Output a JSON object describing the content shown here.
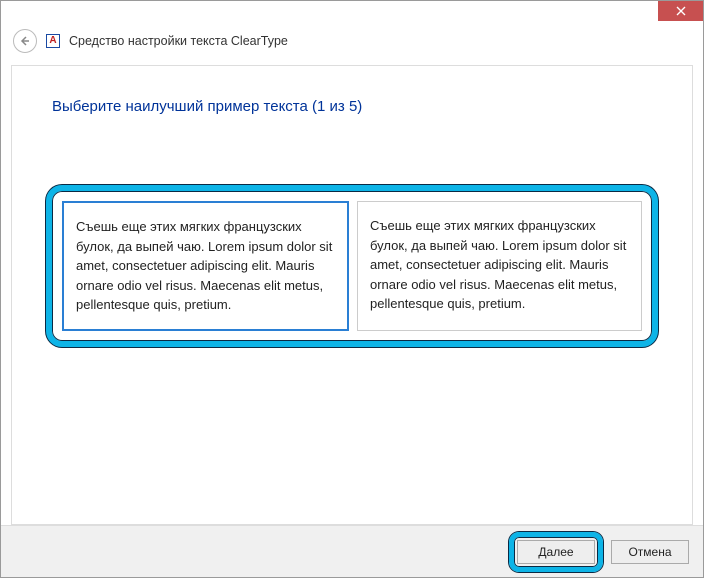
{
  "window": {
    "title": "Средство настройки текста ClearType",
    "app_icon_letter": "A"
  },
  "page": {
    "instruction": "Выберите наилучший пример текста (1 из 5)"
  },
  "samples": [
    {
      "text": "Съешь еще этих мягких французских булок, да выпей чаю. Lorem ipsum dolor sit amet, consectetuer adipiscing elit. Mauris ornare odio vel risus. Maecenas elit metus, pellentesque quis, pretium.",
      "selected": true
    },
    {
      "text": "Съешь еще этих мягких французских булок, да выпей чаю. Lorem ipsum dolor sit amet, consectetuer adipiscing elit. Mauris ornare odio vel risus. Maecenas elit metus, pellentesque quis, pretium.",
      "selected": false
    }
  ],
  "footer": {
    "next_label": "Далее",
    "cancel_label": "Отмена"
  }
}
